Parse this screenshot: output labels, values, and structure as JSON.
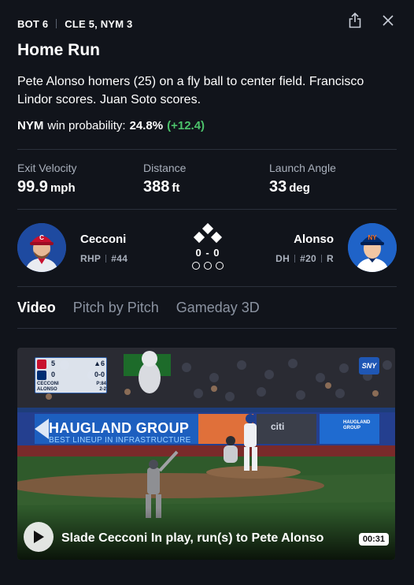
{
  "header": {
    "inning": "BOT 6",
    "score": "CLE 5, NYM 3",
    "share_icon": "share-icon",
    "close_icon": "close-icon"
  },
  "play": {
    "title": "Home Run",
    "description": "Pete Alonso homers (25) on a fly ball to center field. Francisco Lindor scores. Juan Soto scores.",
    "win_prob_team": "NYM",
    "win_prob_label": "win probability:",
    "win_prob_value": "24.8%",
    "win_prob_delta": "(+12.4)",
    "delta_color": "#4cc26b"
  },
  "stats": [
    {
      "label": "Exit Velocity",
      "value": "99.9",
      "unit": "mph"
    },
    {
      "label": "Distance",
      "value": "388",
      "unit": "ft"
    },
    {
      "label": "Launch Angle",
      "value": "33",
      "unit": "deg"
    }
  ],
  "matchup": {
    "pitcher": {
      "name": "Cecconi",
      "position": "RHP",
      "number": "#44",
      "cap_color": "#c8102e"
    },
    "batter": {
      "name": "Alonso",
      "position": "DH",
      "number": "#20",
      "bats": "R",
      "cap_color": "#002d72"
    },
    "count": "0 - 0",
    "bases": {
      "first": true,
      "second": true,
      "third": true
    },
    "outs": 0
  },
  "tabs": [
    {
      "label": "Video",
      "active": true
    },
    {
      "label": "Pitch by Pitch",
      "active": false
    },
    {
      "label": "Gameday 3D",
      "active": false
    }
  ],
  "video": {
    "title": "Slade Cecconi In play, run(s) to Pete Alonso",
    "duration": "00:31",
    "play_icon": "play-icon",
    "scorebug": {
      "away_score": "5",
      "home_score": "0",
      "inning": "▲6",
      "inning_detail": "0-0",
      "pitcher_line": "CECCONI",
      "pitch_count": "P:84",
      "batter_line": "ALONSO",
      "batter_stat": "2-2"
    },
    "network": "SNY",
    "banner_title": "HAUGLAND GROUP",
    "banner_subtitle": "BEST LINEUP IN INFRASTRUCTURE",
    "banner_sponsor": "citi",
    "banner_right": "HAUGLAND GROUP"
  }
}
